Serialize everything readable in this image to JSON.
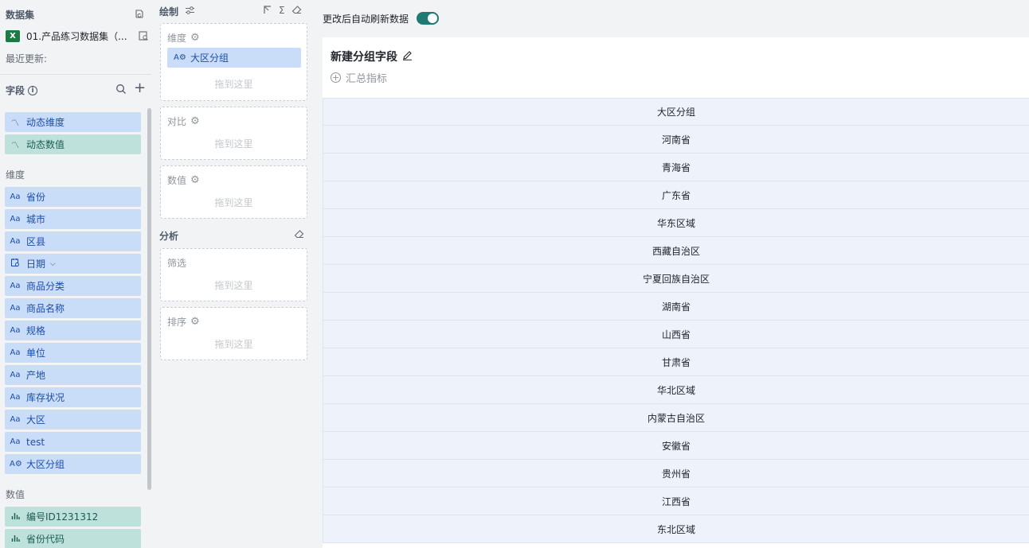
{
  "dataset": {
    "header": "数据集",
    "name": "01.产品练习数据集（...",
    "last_update_label": "最近更新:"
  },
  "fields": {
    "title": "字段",
    "dynamic": [
      {
        "label": "动态维度",
        "kind": "dim",
        "icon": "dynamic-icon"
      },
      {
        "label": "动态数值",
        "kind": "mea",
        "icon": "dynamic-icon"
      }
    ],
    "dimension_label": "维度",
    "dimensions": [
      {
        "label": "省份",
        "icon": "text-type-icon"
      },
      {
        "label": "城市",
        "icon": "text-type-icon"
      },
      {
        "label": "区县",
        "icon": "text-type-icon"
      },
      {
        "label": "日期",
        "icon": "date-type-icon"
      },
      {
        "label": "商品分类",
        "icon": "text-type-icon"
      },
      {
        "label": "商品名称",
        "icon": "text-type-icon"
      },
      {
        "label": "规格",
        "icon": "text-type-icon"
      },
      {
        "label": "单位",
        "icon": "text-type-icon"
      },
      {
        "label": "产地",
        "icon": "text-type-icon"
      },
      {
        "label": "库存状况",
        "icon": "text-type-icon"
      },
      {
        "label": "大区",
        "icon": "text-type-icon"
      },
      {
        "label": "test",
        "icon": "text-type-icon"
      },
      {
        "label": "大区分组",
        "icon": "group-field-icon"
      }
    ],
    "measure_label": "数值",
    "measures": [
      {
        "label": "编号ID1231312",
        "icon": "bar-chart-icon"
      },
      {
        "label": "省份代码",
        "icon": "bar-chart-icon"
      }
    ]
  },
  "draw": {
    "title": "绘制",
    "dimension_box": {
      "label": "维度",
      "chip": "大区分组",
      "hint": "拖到这里"
    },
    "compare_box": {
      "label": "对比",
      "hint": "拖到这里"
    },
    "value_box": {
      "label": "数值",
      "hint": "拖到这里"
    }
  },
  "analysis": {
    "title": "分析",
    "filter_box": {
      "label": "筛选",
      "hint": "拖到这里"
    },
    "sort_box": {
      "label": "排序",
      "hint": "拖到这里"
    }
  },
  "preview": {
    "auto_refresh_label": "更改后自动刷新数据",
    "auto_refresh_on": true,
    "chart_title": "新建分组字段",
    "summary_label": "汇总指标",
    "table": {
      "header": "大区分组",
      "rows": [
        "河南省",
        "青海省",
        "广东省",
        "华东区域",
        "西藏自治区",
        "宁夏回族自治区",
        "湖南省",
        "山西省",
        "甘肃省",
        "华北区域",
        "内蒙古自治区",
        "安徽省",
        "贵州省",
        "江西省",
        "东北区域"
      ]
    }
  },
  "colors": {
    "dimension_bg": "#c9dcf8",
    "measure_bg": "#bfe1dc",
    "toggle_on": "#1f7a73"
  }
}
